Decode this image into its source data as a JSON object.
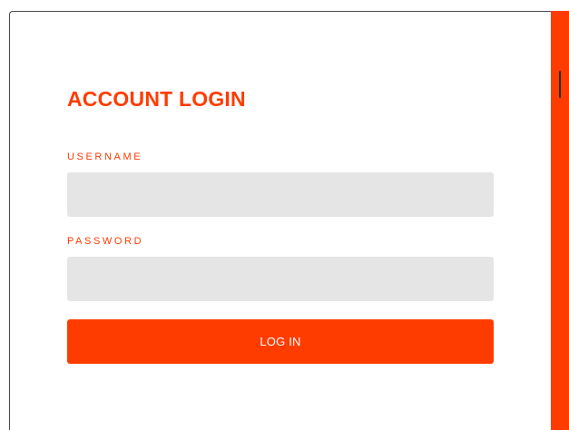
{
  "login": {
    "title": "ACCOUNT LOGIN",
    "username_label": "USERNAME",
    "username_value": "",
    "password_label": "PASSWORD",
    "password_value": "",
    "submit_label": "LOG IN"
  },
  "colors": {
    "accent": "#ff3c00",
    "input_background": "#e5e5e5",
    "card_background": "#ffffff"
  },
  "scrollbar": {
    "handle_icon": "scroll-handle"
  }
}
